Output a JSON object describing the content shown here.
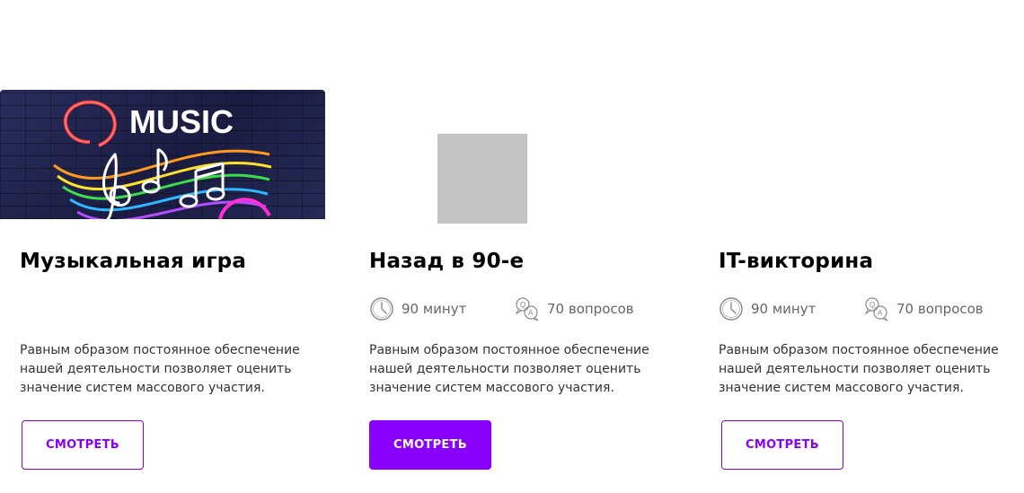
{
  "cards": [
    {
      "title": "Музыкальная игра",
      "image": {
        "type": "photo",
        "logo_text": "MUSIC"
      },
      "description": "Равным образом постоянное обеспечение нашей деятельности позволяет оценить значение систем массового участия.",
      "button_label": "СМОТРЕТЬ",
      "button_style": "outline"
    },
    {
      "title": "Назад в 90-е",
      "image": {
        "type": "placeholder"
      },
      "duration": "90 минут",
      "questions": "70 вопросов",
      "description": "Равным образом постоянное обеспечение нашей деятельности позволяет оценить значение систем массового участия.",
      "button_label": "СМОТРЕТЬ",
      "button_style": "filled"
    },
    {
      "title": "IT-викторина",
      "duration": "90 минут",
      "questions": "70 вопросов",
      "description": "Равным образом постоянное обеспечение нашей деятельности позволяет оценить значение систем массового участия.",
      "button_label": "СМОТРЕТЬ",
      "button_style": "outline"
    }
  ],
  "colors": {
    "accent": "#8a00ff",
    "muted_text": "#666666",
    "placeholder": "#c4c4c4"
  },
  "icons": [
    "clock-icon",
    "qa-icon"
  ]
}
